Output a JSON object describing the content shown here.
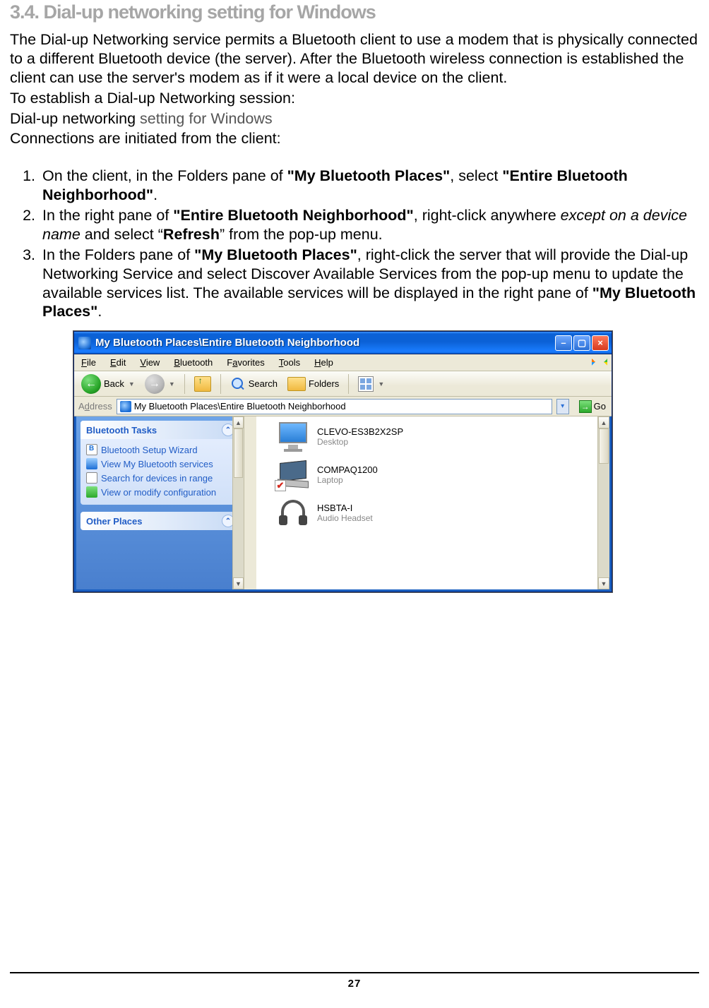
{
  "heading": "3.4. Dial-up networking setting for Windows",
  "intro": {
    "p1": "The Dial-up Networking service permits a Bluetooth client to use a modem that is physically connected to a different Bluetooth device (the server). After the Bluetooth wireless connection is established the client can use the server's modem as if it were a local device on the client.",
    "p2": "To establish a Dial-up Networking session:",
    "p3a": "Dial-up networking ",
    "p3b": "setting for Windows",
    "p4": "Connections are initiated from the client:"
  },
  "steps": {
    "s1_a": "On the client, in the Folders pane of ",
    "s1_b": "\"My Bluetooth Places\"",
    "s1_c": ", select ",
    "s1_d": "\"Entire Bluetooth Neighborhood\"",
    "s1_e": ".",
    "s2_a": "In the right pane of ",
    "s2_b": "\"Entire Bluetooth Neighborhood\"",
    "s2_c": ", right-click anywhere ",
    "s2_d": "except on a device name",
    "s2_e": " and select “",
    "s2_f": "Refresh",
    "s2_g": "” from the pop-up menu.",
    "s3_a": "In the Folders pane of ",
    "s3_b": "\"My Bluetooth Places\"",
    "s3_c": ", right-click the server that will provide the Dial-up Networking Service and select Discover Available Services from the pop-up menu to update the available services list. The available services will be displayed in the right pane of ",
    "s3_d": "\"My Bluetooth Places\"",
    "s3_e": "."
  },
  "window": {
    "title": "My Bluetooth Places\\Entire Bluetooth Neighborhood",
    "menus": {
      "file": "File",
      "edit": "Edit",
      "view": "View",
      "bluetooth": "Bluetooth",
      "favorites": "Favorites",
      "tools": "Tools",
      "help": "Help"
    },
    "toolbar": {
      "back": "Back",
      "search": "Search",
      "folders": "Folders"
    },
    "address": {
      "label": "Address",
      "path": "My Bluetooth Places\\Entire Bluetooth Neighborhood",
      "go": "Go"
    },
    "leftpane": {
      "section1_title": "Bluetooth Tasks",
      "links": {
        "wizard": "Bluetooth Setup Wizard",
        "view": "View My Bluetooth services",
        "search": "Search for devices in range",
        "config": "View or modify configuration"
      },
      "section2_title": "Other Places"
    },
    "devices": [
      {
        "name": "CLEVO-ES3B2X2SP",
        "type": "Desktop"
      },
      {
        "name": "COMPAQ1200",
        "type": "Laptop"
      },
      {
        "name": "HSBTA-I",
        "type": "Audio Headset"
      }
    ]
  },
  "page_number": "27"
}
